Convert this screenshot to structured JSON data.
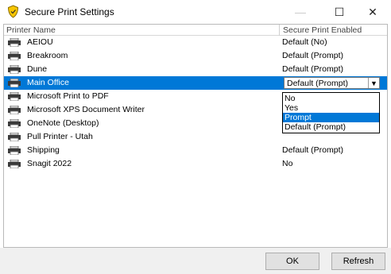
{
  "window": {
    "title": "Secure Print Settings",
    "minimize_icon": "minimize-icon",
    "maximize_icon": "maximize-icon",
    "close_icon": "close-icon",
    "maximize_glyph": "☐",
    "close_glyph": "✕",
    "minimize_glyph": "—"
  },
  "table": {
    "headers": {
      "name": "Printer Name",
      "status": "Secure Print Enabled"
    },
    "rows": [
      {
        "name": "AEIOU",
        "status": "Default (No)"
      },
      {
        "name": "Breakroom",
        "status": "Default (Prompt)"
      },
      {
        "name": "Dune",
        "status": "Default (Prompt)"
      },
      {
        "name": "Main Office",
        "status": "Default (Prompt)"
      },
      {
        "name": "Microsoft Print to PDF",
        "status": ""
      },
      {
        "name": "Microsoft XPS Document Writer",
        "status": ""
      },
      {
        "name": "OneNote (Desktop)",
        "status": ""
      },
      {
        "name": "Pull Printer - Utah",
        "status": ""
      },
      {
        "name": "Shipping",
        "status": "Default (Prompt)"
      },
      {
        "name": "Snagit 2022",
        "status": "No"
      }
    ],
    "selected_row": "Main Office",
    "combo": {
      "value": "Default (Prompt)",
      "arrow_glyph": "▼"
    },
    "dropdown_options": [
      {
        "label": "No",
        "active": false
      },
      {
        "label": "Yes",
        "active": false
      },
      {
        "label": "Prompt",
        "active": true
      },
      {
        "label": "Default (Prompt)",
        "active": false
      }
    ]
  },
  "buttons": {
    "ok": "OK",
    "refresh": "Refresh"
  },
  "colors": {
    "accent": "#0078d7",
    "shield": "#f7c600"
  }
}
